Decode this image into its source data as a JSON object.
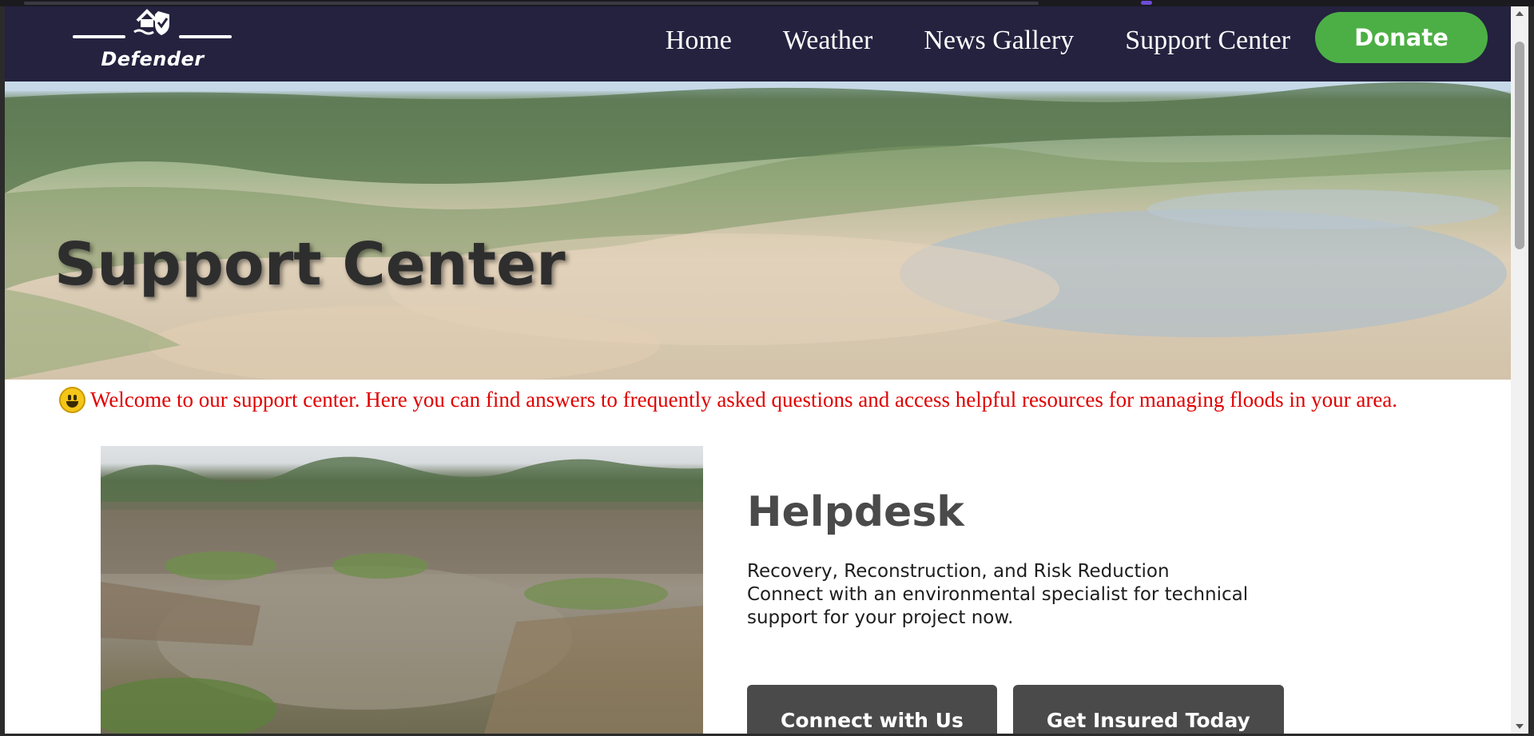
{
  "brand": {
    "name": "Defender",
    "logo_icon": "house-shield-wave-icon"
  },
  "nav": {
    "links": [
      "Home",
      "Weather",
      "News Gallery",
      "Support Center"
    ],
    "donate_label": "Donate"
  },
  "hero": {
    "title": "Support Center"
  },
  "marquee": {
    "emoji": "grinning-face-icon",
    "text": "Welcome to our support center. Here you can find answers to frequently asked questions and access helpful resources for managing floods in your area."
  },
  "helpdesk": {
    "title": "Helpdesk",
    "line1": "Recovery, Reconstruction, and Risk Reduction",
    "line2": "Connect with an environmental specialist for technical support for your project now.",
    "buttons": [
      "Connect with Us",
      "Get Insured Today"
    ]
  },
  "colors": {
    "nav_bg": "#24223f",
    "donate_green": "#4caf45",
    "marquee_red": "#e00000",
    "button_gray": "#4a4a4a"
  }
}
